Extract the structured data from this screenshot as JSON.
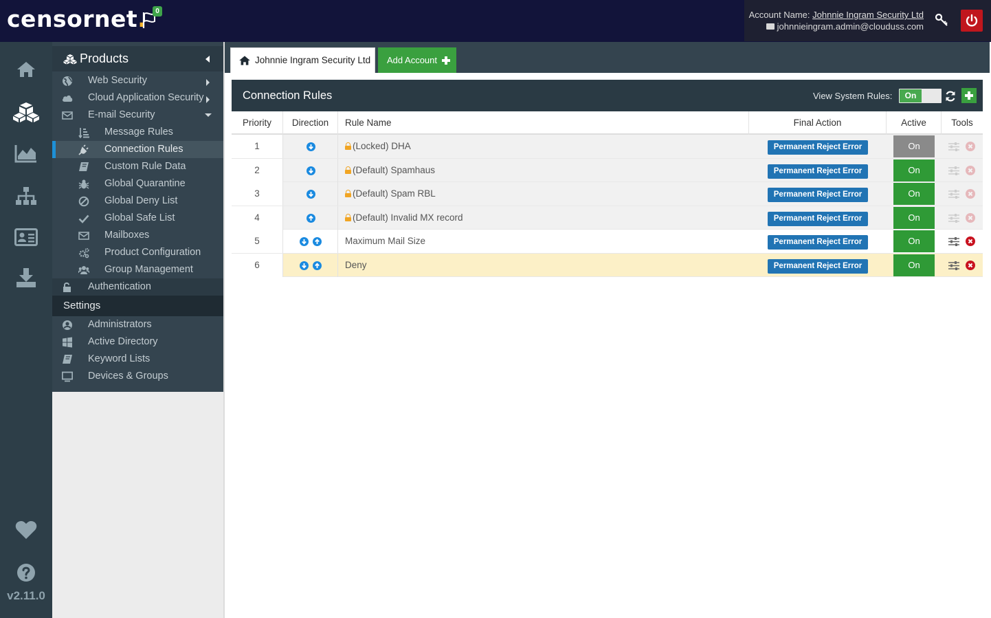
{
  "app": {
    "logo_text": "censornet",
    "logo_dot": ".",
    "notifications_count": "0",
    "version": "v2.11.0"
  },
  "account": {
    "name_label": "Account Name:",
    "name": "Johnnie Ingram Security Ltd",
    "email": "johnnieingram.admin@clouduss.com"
  },
  "rail": [
    {
      "icon": "home-icon"
    },
    {
      "icon": "products-cubes-icon"
    },
    {
      "icon": "reports-chart-icon"
    },
    {
      "icon": "network-tree-icon"
    },
    {
      "icon": "user-card-icon"
    },
    {
      "icon": "download-icon"
    },
    {
      "icon": "heart-icon"
    },
    {
      "icon": "help-icon"
    }
  ],
  "sidebar": {
    "products_label": "Products",
    "items": [
      {
        "label": "Web Security",
        "icon": "globe-icon"
      },
      {
        "label": "Cloud Application Security",
        "icon": "cloud-icon"
      },
      {
        "label": "E-mail Security",
        "icon": "envelope-icon"
      },
      {
        "label": "Message Rules",
        "icon": "sort-icon"
      },
      {
        "label": "Connection Rules",
        "icon": "plug-icon"
      },
      {
        "label": "Custom Rule Data",
        "icon": "book-icon"
      },
      {
        "label": "Global Quarantine",
        "icon": "bug-icon"
      },
      {
        "label": "Global Deny List",
        "icon": "ban-icon"
      },
      {
        "label": "Global Safe List",
        "icon": "check-icon"
      },
      {
        "label": "Mailboxes",
        "icon": "envelope-icon"
      },
      {
        "label": "Product Configuration",
        "icon": "gears-icon"
      },
      {
        "label": "Group Management",
        "icon": "users-icon"
      },
      {
        "label": "Authentication",
        "icon": "unlock-icon"
      }
    ],
    "settings_label": "Settings",
    "settings_items": [
      {
        "label": "Administrators",
        "icon": "user-circle-icon"
      },
      {
        "label": "Active Directory",
        "icon": "windows-icon"
      },
      {
        "label": "Keyword Lists",
        "icon": "book-icon"
      },
      {
        "label": "Devices & Groups",
        "icon": "monitor-icon"
      }
    ]
  },
  "tabs": {
    "home_label": "Johnnie Ingram Security Ltd",
    "add_label": "Add Account"
  },
  "panel": {
    "title": "Connection Rules",
    "view_system_rules_label": "View System Rules:",
    "view_system_rules_state": "On"
  },
  "table": {
    "headers": [
      "Priority",
      "Direction",
      "Rule Name",
      "Final Action",
      "Active",
      "Tools"
    ],
    "rows": [
      {
        "priority": "1",
        "direction": [
          "down"
        ],
        "locked": true,
        "name": "(Locked) DHA",
        "final_action": "Permanent Reject Error",
        "active": "On",
        "active_style": "grey",
        "tools_enabled": false
      },
      {
        "priority": "2",
        "direction": [
          "down"
        ],
        "locked": true,
        "name": "(Default) Spamhaus",
        "final_action": "Permanent Reject Error",
        "active": "On",
        "active_style": "green",
        "tools_enabled": false
      },
      {
        "priority": "3",
        "direction": [
          "down"
        ],
        "locked": true,
        "name": "(Default) Spam RBL",
        "final_action": "Permanent Reject Error",
        "active": "On",
        "active_style": "green",
        "tools_enabled": false
      },
      {
        "priority": "4",
        "direction": [
          "up"
        ],
        "locked": true,
        "name": "(Default) Invalid MX record",
        "final_action": "Permanent Reject Error",
        "active": "On",
        "active_style": "green",
        "tools_enabled": false
      },
      {
        "priority": "5",
        "direction": [
          "down",
          "up"
        ],
        "locked": false,
        "name": "Maximum Mail Size",
        "final_action": "Permanent Reject Error",
        "active": "On",
        "active_style": "green",
        "tools_enabled": true
      },
      {
        "priority": "6",
        "direction": [
          "down",
          "up"
        ],
        "locked": false,
        "name": "Deny",
        "final_action": "Permanent Reject Error",
        "active": "On",
        "active_style": "green",
        "tools_enabled": true,
        "highlighted": true
      }
    ]
  },
  "colors": {
    "topbar": "#12143a",
    "rail": "#2d3e48",
    "sidebar": "#34444f",
    "accent_green": "#3aa03f",
    "action_blue": "#2174b4",
    "danger_red": "#c8121f",
    "highlight_row": "#fcf0c7"
  }
}
